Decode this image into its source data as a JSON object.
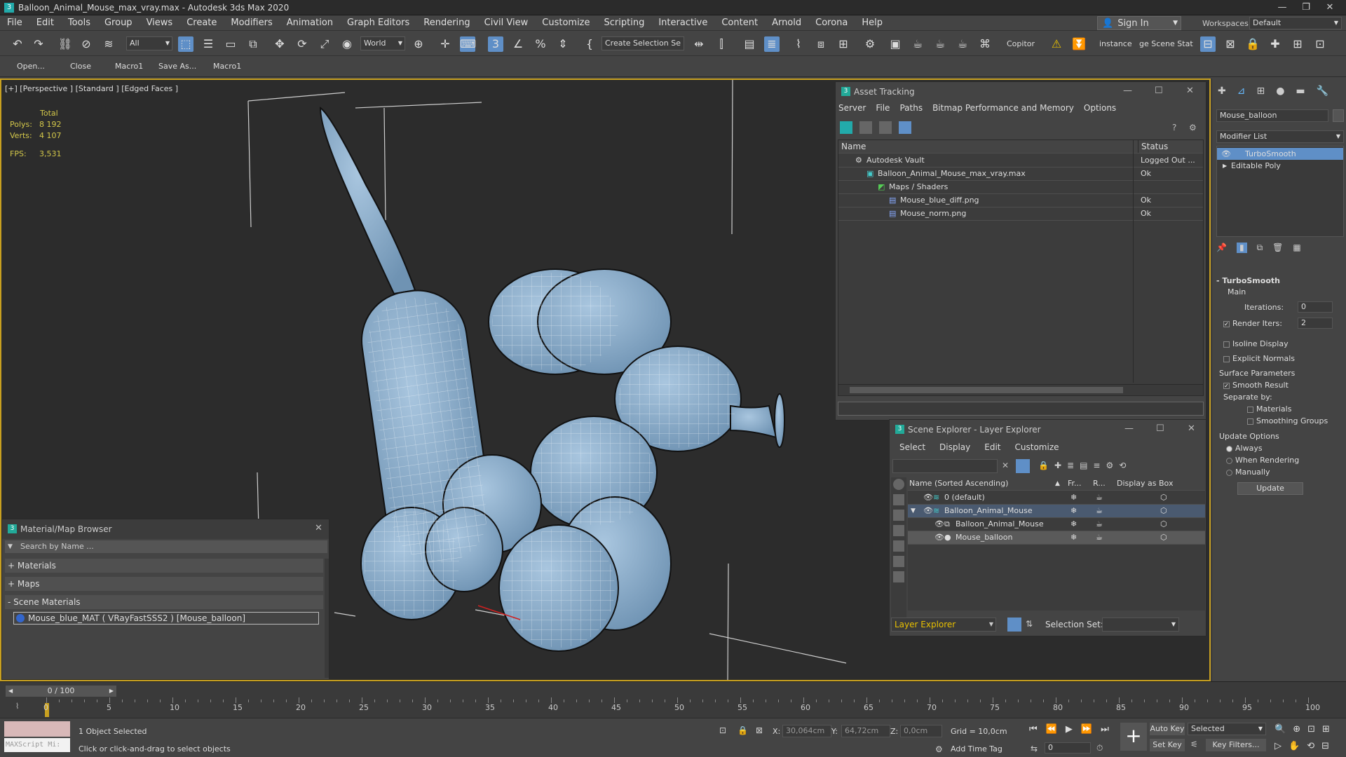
{
  "window": {
    "title": "Balloon_Animal_Mouse_max_vray.max - Autodesk 3ds Max 2020",
    "min": "—",
    "max": "❐",
    "close": "✕"
  },
  "menu": [
    "File",
    "Edit",
    "Tools",
    "Group",
    "Views",
    "Create",
    "Modifiers",
    "Animation",
    "Graph Editors",
    "Rendering",
    "Civil View",
    "Customize",
    "Scripting",
    "Interactive",
    "Content",
    "Arnold",
    "Corona",
    "Help"
  ],
  "signin": {
    "label": "Sign In"
  },
  "workspaces": {
    "label": "Workspaces:",
    "value": "Default"
  },
  "toolbar": {
    "selection_filter": "All",
    "coord_system": "World",
    "create_selection_set": "Create Selection Se",
    "copitor": "Copitor",
    "instance": "instance",
    "scene_stat": "ge Scene Stat"
  },
  "quickbar": [
    "Open...",
    "Close",
    "Macro1",
    "Save As...",
    "Macro1"
  ],
  "viewport": {
    "label": "[+] [Perspective ] [Standard ] [Edged Faces ]",
    "stats": {
      "total_label": "Total",
      "polys_label": "Polys:",
      "polys": "8 192",
      "verts_label": "Verts:",
      "verts": "4 107",
      "fps_label": "FPS:",
      "fps": "3,531"
    }
  },
  "asset_tracking": {
    "title": "Asset Tracking",
    "menu": [
      "Server",
      "File",
      "Paths",
      "Bitmap Performance and Memory",
      "Options"
    ],
    "columns": [
      "Name",
      "Status"
    ],
    "rows": [
      {
        "name": "Autodesk Vault",
        "status": "Logged Out ..."
      },
      {
        "name": "Balloon_Animal_Mouse_max_vray.max",
        "status": "Ok"
      },
      {
        "name": "Maps / Shaders",
        "status": ""
      },
      {
        "name": "Mouse_blue_diff.png",
        "status": "Ok"
      },
      {
        "name": "Mouse_norm.png",
        "status": "Ok"
      }
    ]
  },
  "scene_explorer": {
    "title": "Scene Explorer - Layer Explorer",
    "menu": [
      "Select",
      "Display",
      "Edit",
      "Customize"
    ],
    "columns": [
      "Name (Sorted Ascending)",
      "Fr...",
      "R...",
      "Display as Box"
    ],
    "rows": [
      {
        "name": "0 (default)"
      },
      {
        "name": "Balloon_Animal_Mouse"
      },
      {
        "name": "Balloon_Animal_Mouse"
      },
      {
        "name": "Mouse_balloon"
      }
    ],
    "footer_dropdown": "Layer Explorer",
    "selection_set_label": "Selection Set:"
  },
  "material_browser": {
    "title": "Material/Map Browser",
    "search_placeholder": "Search by Name ...",
    "sections": [
      "+ Materials",
      "+ Maps",
      "- Scene Materials"
    ],
    "item": "Mouse_blue_MAT  ( VRayFastSSS2 ) [Mouse_balloon]"
  },
  "command_panel": {
    "object_name": "Mouse_balloon",
    "modifier_list": "Modifier List",
    "stack": [
      "TurboSmooth",
      "Editable Poly"
    ],
    "rollout": "TurboSmooth",
    "main": "Main",
    "iterations_label": "Iterations:",
    "iterations": "0",
    "render_iters_label": "Render Iters:",
    "render_iters": "2",
    "isoline": "Isoline Display",
    "explicit": "Explicit Normals",
    "surface": "Surface Parameters",
    "smooth_result": "Smooth Result",
    "separate": "Separate by:",
    "materials": "Materials",
    "smoothing_groups": "Smoothing Groups",
    "update_options": "Update Options",
    "always": "Always",
    "when_rendering": "When Rendering",
    "manually": "Manually",
    "update": "Update"
  },
  "timeline": {
    "frame": "0 / 100",
    "ticks": [
      "0",
      "5",
      "10",
      "15",
      "20",
      "25",
      "30",
      "35",
      "40",
      "45",
      "50",
      "55",
      "60",
      "65",
      "70",
      "75",
      "80",
      "85",
      "90",
      "95",
      "100"
    ]
  },
  "status": {
    "maxscript": "MAXScript Mi:",
    "selected": "1 Object Selected",
    "hint": "Click or click-and-drag to select objects",
    "x_label": "X:",
    "x": "30,064cm",
    "y_label": "Y:",
    "y": "64,72cm",
    "z_label": "Z:",
    "z": "0,0cm",
    "grid": "Grid = 10,0cm",
    "add_time_tag": "Add Time Tag",
    "auto_key": "Auto Key",
    "selected_dropdown": "Selected",
    "set_key": "Set Key",
    "key_filters": "Key Filters...",
    "frame_field": "0"
  }
}
